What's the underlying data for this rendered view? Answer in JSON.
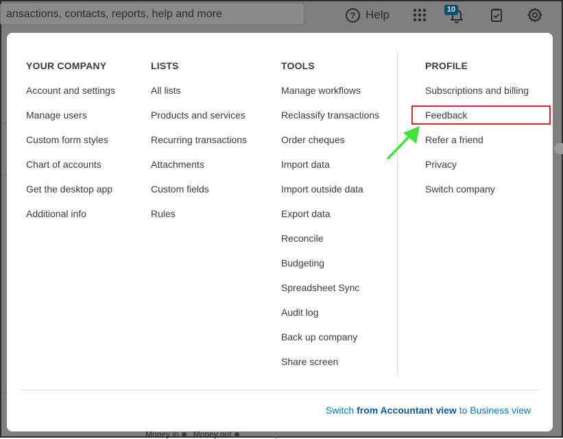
{
  "topbar": {
    "search_text": "ansactions, contacts, reports, help and more",
    "help_label": "Help",
    "notification_count": "10",
    "icons": [
      "help-icon",
      "apps-grid-icon",
      "bell-icon",
      "clipboard-icon",
      "gear-icon"
    ]
  },
  "background": {
    "money_in": "Money in",
    "money_out": "Money out"
  },
  "menu": {
    "your_company": {
      "heading": "YOUR COMPANY",
      "items": [
        "Account and settings",
        "Manage users",
        "Custom form styles",
        "Chart of accounts",
        "Get the desktop app",
        "Additional info"
      ]
    },
    "lists": {
      "heading": "LISTS",
      "items": [
        "All lists",
        "Products and services",
        "Recurring transactions",
        "Attachments",
        "Custom fields",
        "Rules"
      ]
    },
    "tools": {
      "heading": "TOOLS",
      "items": [
        "Manage workflows",
        "Reclassify transactions",
        "Order cheques",
        "Import data",
        "Import outside data",
        "Export data",
        "Reconcile",
        "Budgeting",
        "Spreadsheet Sync",
        "Audit log",
        "Back up company",
        "Share screen"
      ]
    },
    "profile": {
      "heading": "PROFILE",
      "items": [
        "Subscriptions and billing",
        "Feedback",
        "Refer a friend",
        "Privacy",
        "Switch company"
      ]
    }
  },
  "footer": {
    "switch_prefix": "Switch ",
    "switch_bold": "from Accountant view",
    "switch_suffix": " to Business view"
  },
  "annotation": {
    "highlight_color": "#e0202a",
    "arrow_color": "#3fe23a",
    "highlighted_item": "Feedback"
  }
}
